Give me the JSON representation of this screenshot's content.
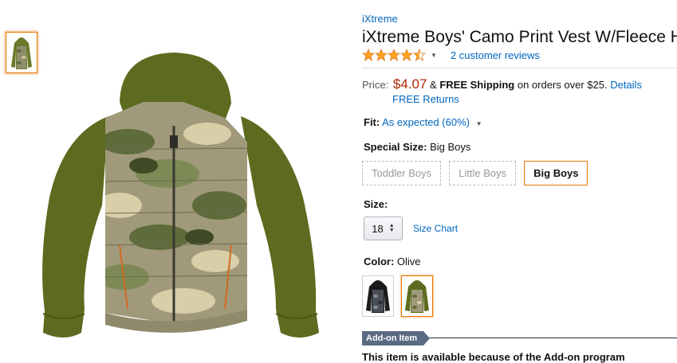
{
  "product": {
    "brand": "iXtreme",
    "title": "iXtreme Boys' Camo Print Vest W/Fleece H",
    "rating_stars": 4.5,
    "reviews_label": "2 customer reviews"
  },
  "price": {
    "label": "Price:",
    "amount": "$4.07",
    "ampersand": "&",
    "free_shipping": "FREE Shipping",
    "shipping_suffix": "on orders over $25.",
    "details_link": "Details",
    "returns_link": "FREE Returns"
  },
  "fit": {
    "label": "Fit:",
    "value": "As expected (60%)"
  },
  "special_size": {
    "label": "Special Size:",
    "value": "Big Boys",
    "options": [
      "Toddler Boys",
      "Little Boys",
      "Big Boys"
    ]
  },
  "size": {
    "label": "Size:",
    "selected": "18",
    "chart_link": "Size Chart"
  },
  "color": {
    "label": "Color:",
    "value": "Olive"
  },
  "addon": {
    "badge": "Add-on Item",
    "text": "This item is available because of the Add-on program"
  },
  "colors": {
    "link": "#0066c0",
    "price": "#b12704",
    "selected_border": "#e77600",
    "olive": "#5c6b1f",
    "star": "#ffa41c"
  },
  "icons": {
    "star": "star-icon",
    "caret": "caret-down-icon",
    "jacket": "jacket-icon"
  }
}
